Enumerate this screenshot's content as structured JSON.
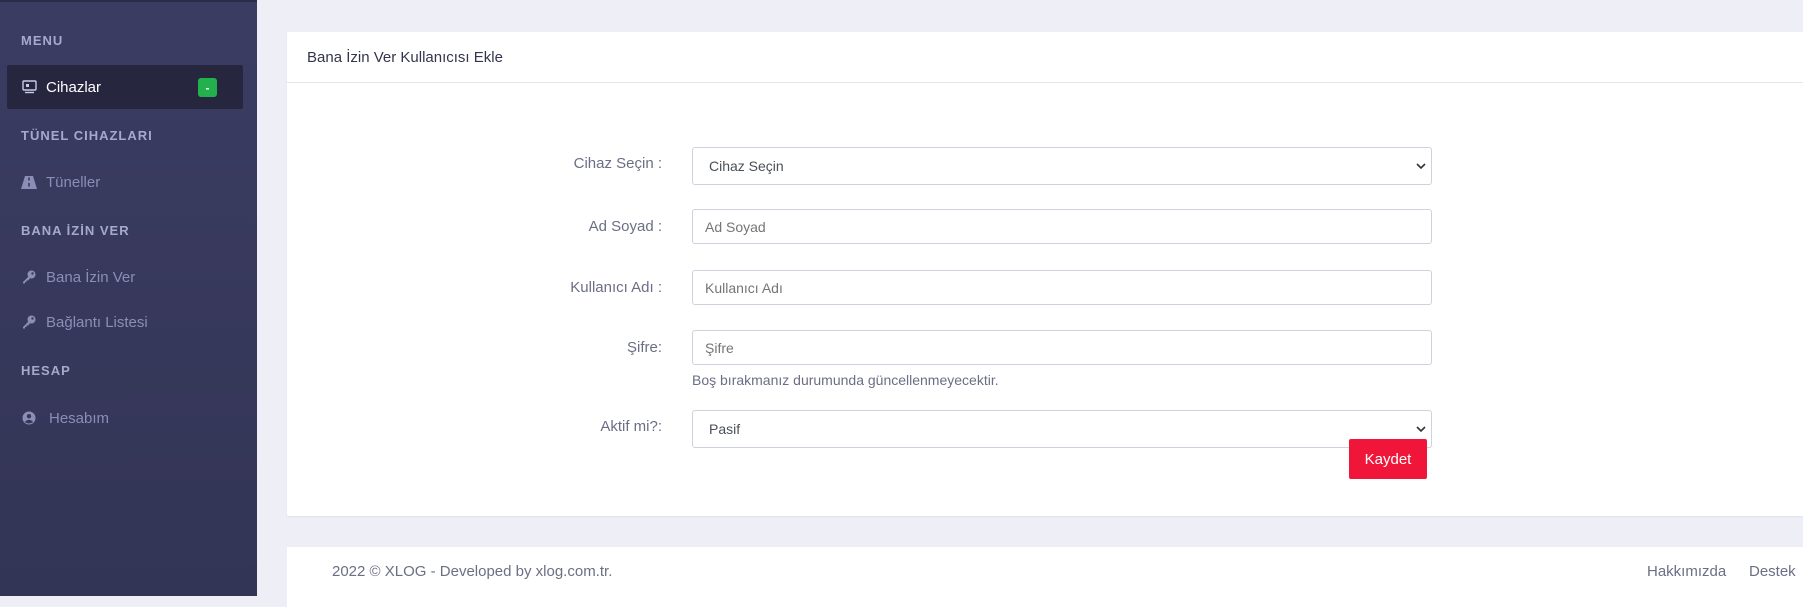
{
  "sidebar": {
    "sections": {
      "menu": "MENU",
      "tunnel": "TÜNEL CIHAZLARI",
      "allow": "BANA İZİN VER",
      "account": "HESAP"
    },
    "items": {
      "devices": {
        "label": "Cihazlar",
        "badge": "-",
        "icon": "monitor-icon"
      },
      "tunnels": {
        "label": "Tüneller",
        "icon": "road-icon"
      },
      "allow_me": {
        "label": "Bana İzin Ver",
        "icon": "key-icon"
      },
      "connections": {
        "label": "Bağlantı Listesi",
        "icon": "key-icon"
      },
      "my_account": {
        "label": "Hesabım",
        "icon": "user-circle-icon"
      }
    }
  },
  "card": {
    "title": "Bana İzin Ver Kullanıcısı Ekle",
    "form": {
      "device": {
        "label": "Cihaz Seçin :",
        "selected": "Cihaz Seçin"
      },
      "fullname": {
        "label": "Ad Soyad :",
        "placeholder": "Ad Soyad"
      },
      "username": {
        "label": "Kullanıcı Adı :",
        "placeholder": "Kullanıcı Adı"
      },
      "password": {
        "label": "Şifre:",
        "placeholder": "Şifre",
        "hint": "Boş bırakmanız durumunda güncellenmeyecektir."
      },
      "active": {
        "label": "Aktif mi?:",
        "selected": "Pasif"
      },
      "save_label": "Kaydet"
    }
  },
  "footer": {
    "copyright": "2022 © XLOG - Developed by  xlog.com.tr.",
    "links": {
      "about": "Hakkımızda",
      "support": "Destek"
    }
  },
  "colors": {
    "sidebar_bg": "#3b3c62",
    "active_item_bg": "#26273f",
    "badge": "#22b14c",
    "save_button": "#f0163a"
  }
}
